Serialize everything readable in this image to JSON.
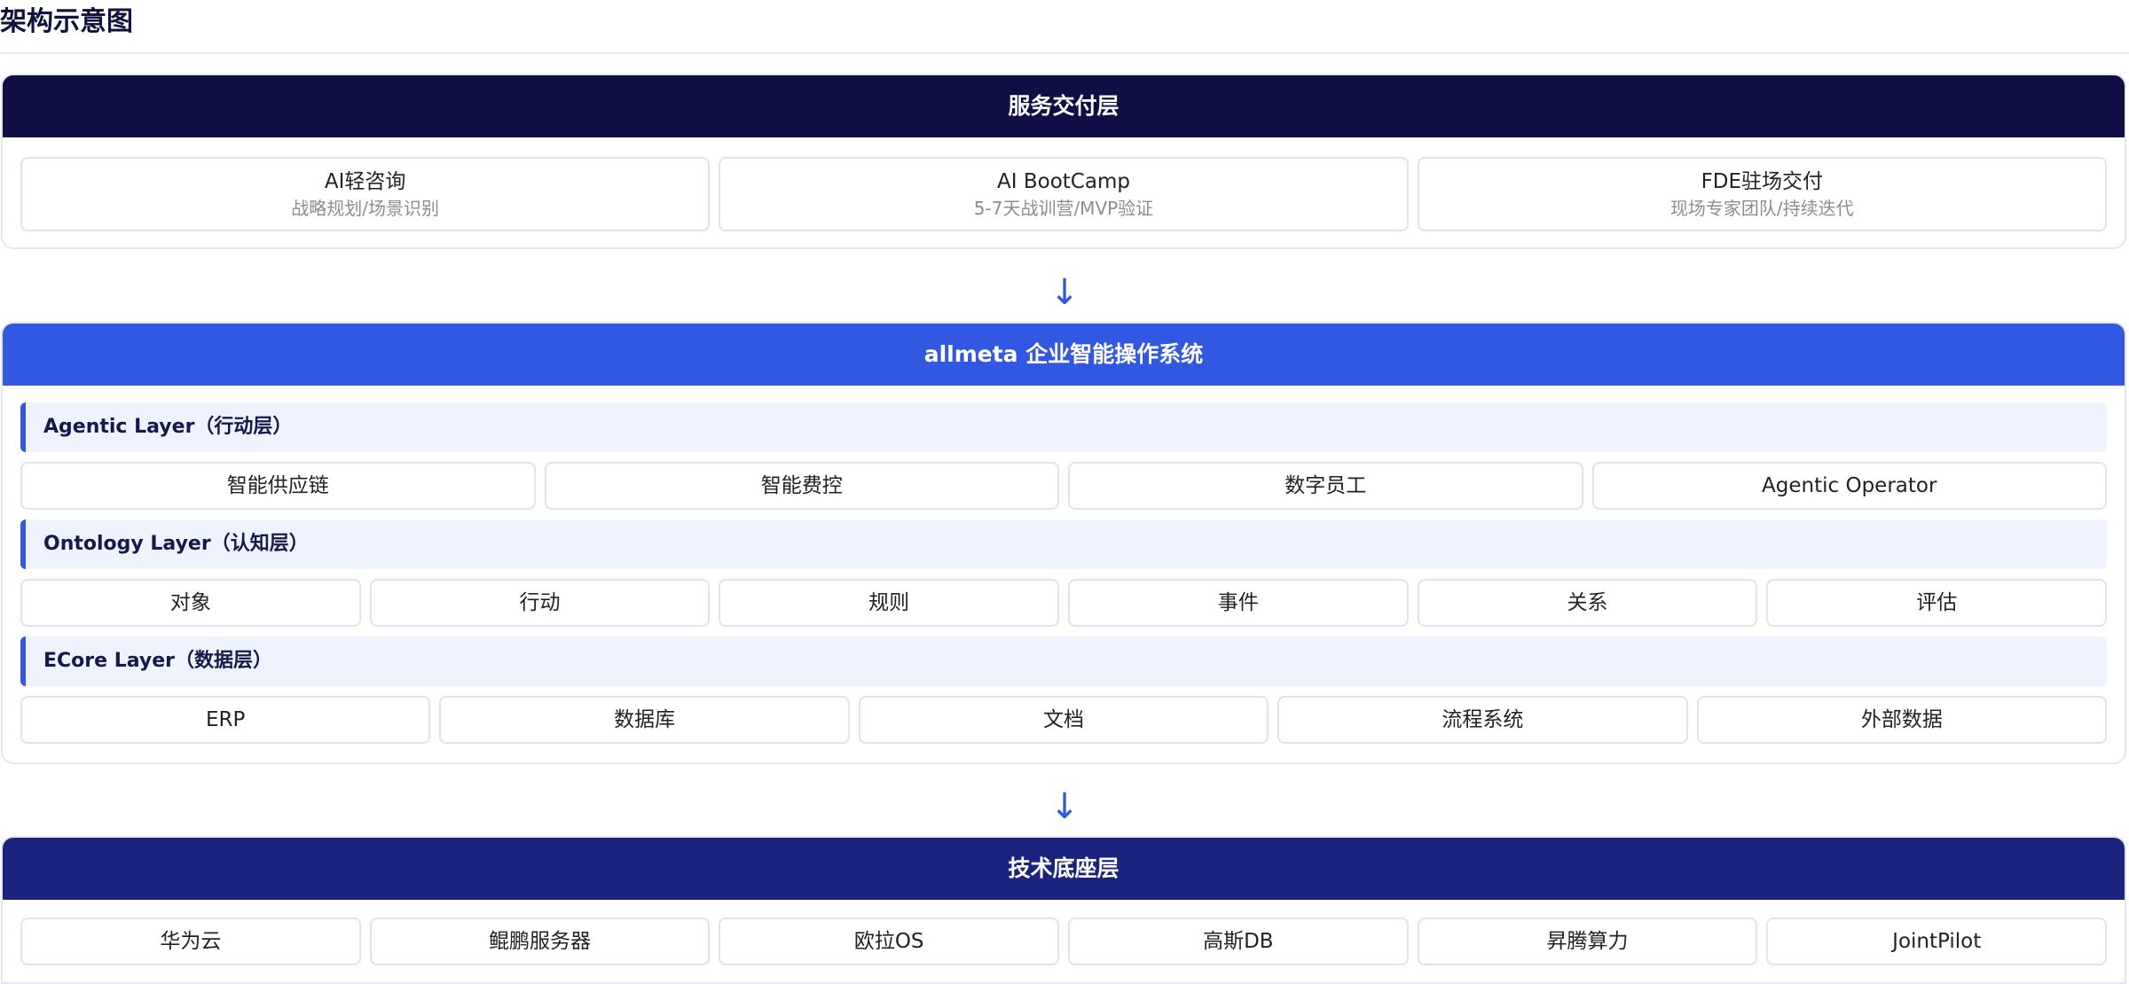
{
  "page_title": "架构示意图",
  "colors": {
    "service_header": "#0f0e45",
    "os_header": "#3257e0",
    "tech_header": "#1a237e",
    "accent": "#3257e0",
    "layer_bg": "#eef3fd"
  },
  "service_layer": {
    "title": "服务交付层",
    "items": [
      {
        "title": "AI轻咨询",
        "sub": "战略规划/场景识别"
      },
      {
        "title": "AI BootCamp",
        "sub": "5-7天战训营/MVP验证"
      },
      {
        "title": "FDE驻场交付",
        "sub": "现场专家团队/持续迭代"
      }
    ]
  },
  "arrow_glyph": "↓",
  "os_layer": {
    "title": "allmeta 企业智能操作系统",
    "agentic": {
      "label": "Agentic Layer（行动层）",
      "items": [
        "智能供应链",
        "智能费控",
        "数字员工",
        "Agentic Operator"
      ]
    },
    "ontology": {
      "label": "Ontology Layer（认知层）",
      "items": [
        "对象",
        "行动",
        "规则",
        "事件",
        "关系",
        "评估"
      ]
    },
    "ecore": {
      "label": "ECore Layer（数据层）",
      "items": [
        "ERP",
        "数据库",
        "文档",
        "流程系统",
        "外部数据"
      ]
    }
  },
  "tech_layer": {
    "title": "技术底座层",
    "items": [
      "华为云",
      "鲲鹏服务器",
      "欧拉OS",
      "高斯DB",
      "昇腾算力",
      "JointPilot"
    ]
  }
}
